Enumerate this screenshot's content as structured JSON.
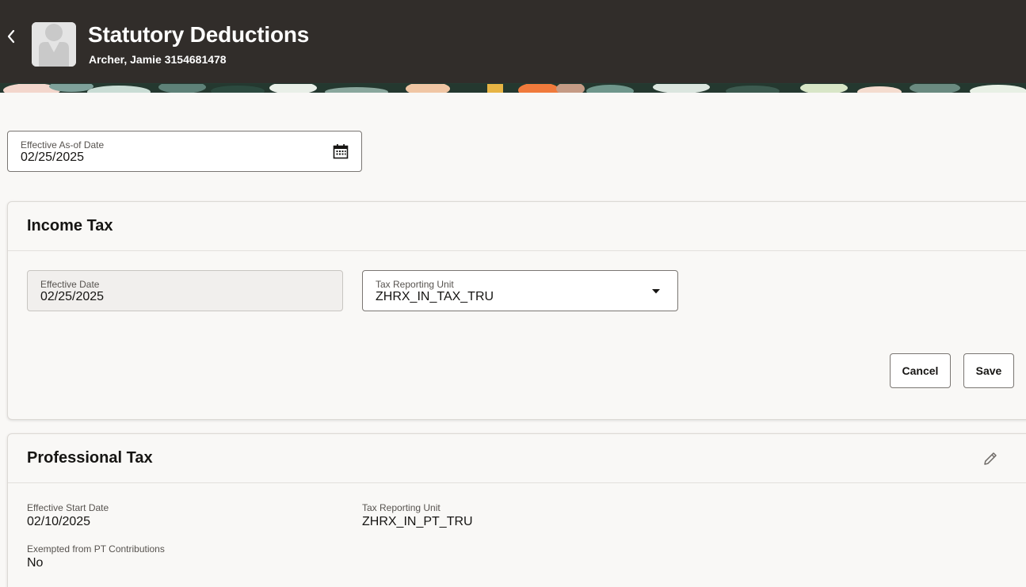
{
  "header": {
    "title": "Statutory Deductions",
    "subtitle": "Archer, Jamie 3154681478",
    "back_icon": "chevron-left-icon",
    "avatar_icon": "person-placeholder-icon"
  },
  "as_of_date": {
    "label": "Effective As-of Date",
    "value": "02/25/2025",
    "icon": "calendar-icon"
  },
  "income_tax": {
    "title": "Income Tax",
    "effective_date": {
      "label": "Effective Date",
      "value": "02/25/2025"
    },
    "tax_reporting_unit": {
      "label": "Tax Reporting Unit",
      "value": "ZHRX_IN_TAX_TRU",
      "icon": "caret-down-icon"
    },
    "cancel_label": "Cancel",
    "save_label": "Save"
  },
  "professional_tax": {
    "title": "Professional Tax",
    "edit_icon": "pencil-icon",
    "fields": {
      "effective_start_date": {
        "label": "Effective Start Date",
        "value": "02/10/2025"
      },
      "tax_reporting_unit": {
        "label": "Tax Reporting Unit",
        "value": "ZHRX_IN_PT_TRU"
      },
      "exempted": {
        "label": "Exempted from PT Contributions",
        "value": "No"
      }
    }
  },
  "colors": {
    "header_bg": "#312d2a",
    "page_bg": "#f9f8f6",
    "text": "#161513",
    "label": "#57534f"
  }
}
